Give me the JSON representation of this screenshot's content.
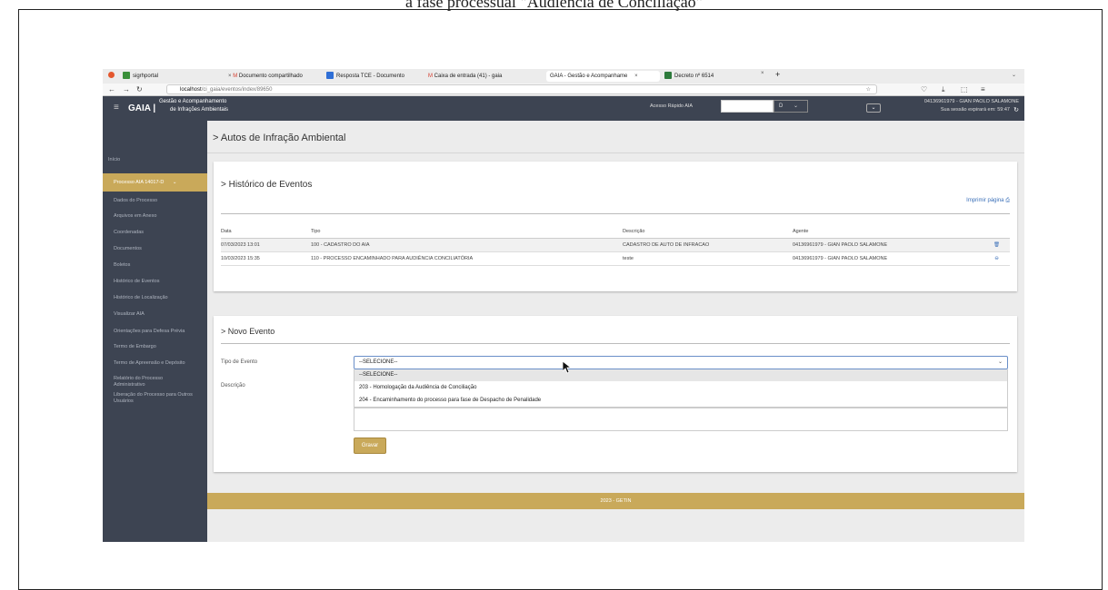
{
  "caption": "a fase processual \"Audiência de Conciliação\"",
  "browser": {
    "tabs": [
      {
        "label": "sigrhportal",
        "color": "#3a8f3a"
      },
      {
        "label": "Documento compartilhado",
        "color": "#d33b2c"
      },
      {
        "label": "Resposta TCE - Documento",
        "color": "#2f6fd6"
      },
      {
        "label": "Caixa de entrada (41) - gaia",
        "color": "#d33b2c"
      },
      {
        "label": "GAIA - Gestão e Acompanhame",
        "color": "#ffffff"
      },
      {
        "label": "Decreto nº 6514",
        "color": "#2d7a3c"
      }
    ],
    "new_tab": "+",
    "url_host": "localhost",
    "url_path": "/ci_gaia/eventos/index/89650"
  },
  "app": {
    "brand": "GAIA |",
    "subtitle_line1": "Gestão e Acompanhamento",
    "subtitle_line2": "de Infrações Ambientais",
    "quick_access_label": "Acesso Rápido AIA",
    "quick_access_value": "",
    "quick_access_suffix": "D",
    "user": "04136961979 - GIAN PAOLO SALAMONE",
    "session": "Sua sessão expirará em: 59:47"
  },
  "sidebar": {
    "inicio": "Início",
    "active": "Processo AIA 14017-D",
    "items": [
      "Dados do Processo",
      "Arquivos em Anexo",
      "Coordenadas",
      "Documentos",
      "Boletos",
      "Histórico de Eventos",
      "Histórico de Localização",
      "Visualizar AIA",
      "Orientações para Defesa Prévia",
      "Termo de Embargo",
      "Termo de Apreensão e Depósito",
      "Relatório do Processo Administrativo",
      "Liberação do Processo para Outros Usuários"
    ]
  },
  "page_title": "> Autos de Infração Ambiental",
  "historico": {
    "title": "> Histórico de Eventos",
    "print": "Imprimir página",
    "headers": [
      "Data",
      "Tipo",
      "Descrição",
      "Agente"
    ],
    "rows": [
      {
        "data": "07/03/2023 13:01",
        "tipo": "100 - CADASTRO DO AIA",
        "descricao": "CADASTRO DE AUTO DE INFRACAO",
        "agente": "04136961979 - GIAN PAOLO SALAMONE"
      },
      {
        "data": "10/03/2023 15:35",
        "tipo": "110 - PROCESSO ENCAMINHADO PARA AUDIÊNCIA CONCILIATÓRIA",
        "descricao": "teste",
        "agente": "04136961979 - GIAN PAOLO SALAMONE"
      }
    ]
  },
  "novo": {
    "title": "> Novo Evento",
    "tipo_label": "Tipo de Evento",
    "descricao_label": "Descrição",
    "select_value": "--SELECIONE--",
    "options": [
      "--SELECIONE--",
      "203 - Homologação da Audiência de Conciliação",
      "204 - Encaminhamento do processo para fase de Despacho de Penalidade"
    ],
    "save": "Gravar"
  },
  "footer": "2023 - GETIN"
}
